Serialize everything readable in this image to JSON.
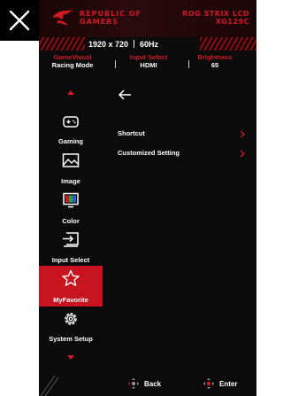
{
  "header": {
    "brand": "REPUBLIC OF GAMERS",
    "model": "ROG STRIX LCD XG129C"
  },
  "resolution_bar": {
    "resolution": "1920 x 720",
    "refresh": "60Hz"
  },
  "status": {
    "gamevisual_label": "GameVisual",
    "gamevisual_value": "Racing Mode",
    "input_label": "Input Select",
    "input_value": "HDMI",
    "brightness_label": "Brightness",
    "brightness_value": "65"
  },
  "sidebar": {
    "items": [
      {
        "label": "Gaming",
        "icon": "gamepad-icon"
      },
      {
        "label": "Image",
        "icon": "image-icon"
      },
      {
        "label": "Color",
        "icon": "color-icon"
      },
      {
        "label": "Input Select",
        "icon": "input-icon"
      },
      {
        "label": "MyFavorite",
        "icon": "star-icon",
        "active": true
      },
      {
        "label": "System Setup",
        "icon": "gear-icon"
      }
    ]
  },
  "panel": {
    "items": [
      {
        "label": "Shortcut"
      },
      {
        "label": "Customized Setting"
      }
    ]
  },
  "footer": {
    "back_label": "Back",
    "enter_label": "Enter"
  },
  "colors": {
    "accent": "#d01824",
    "active_bg": "#c8141e",
    "osd_bg": "#0b0b0b"
  }
}
